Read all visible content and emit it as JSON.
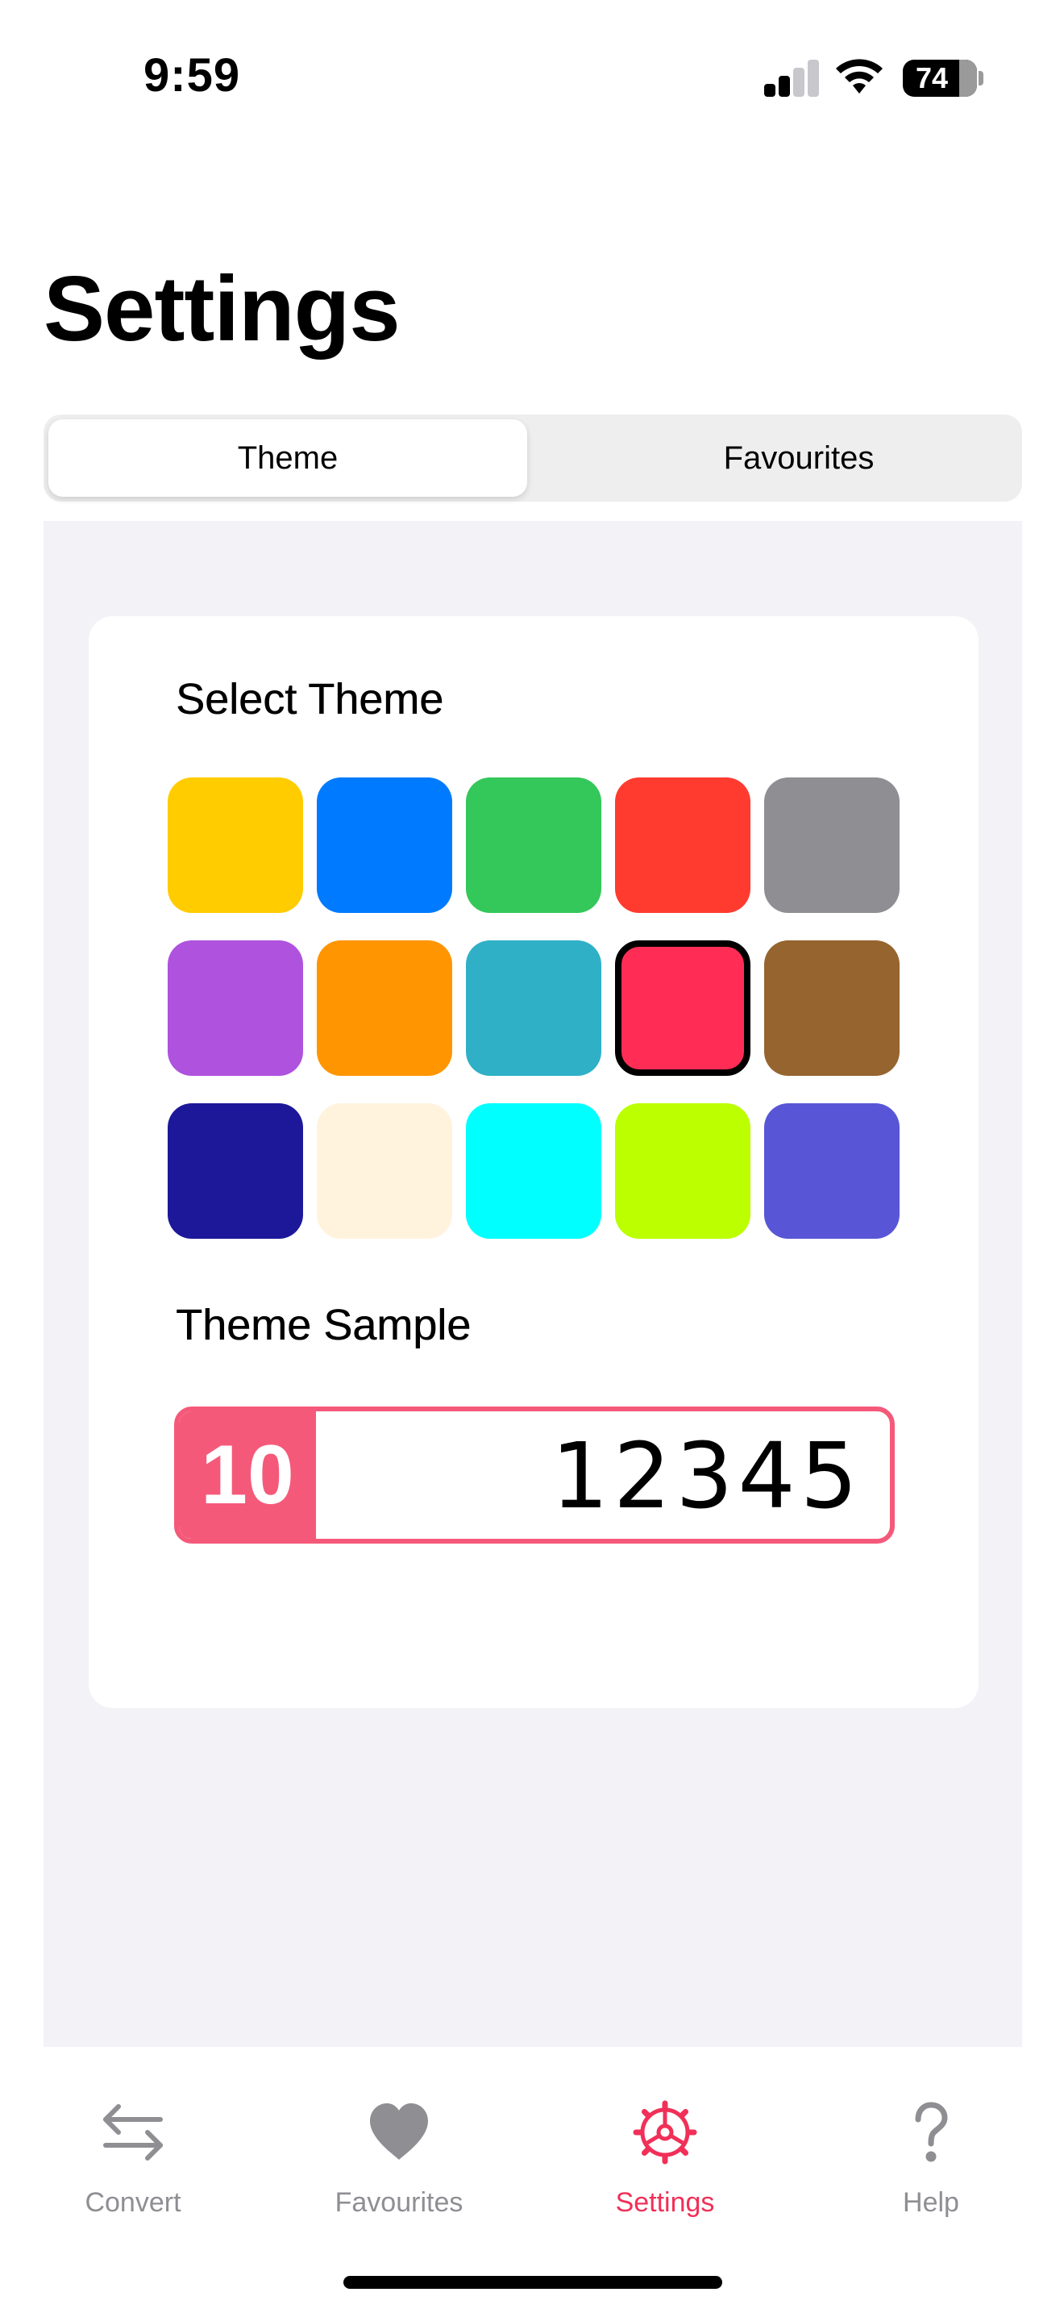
{
  "status_bar": {
    "time": "9:59",
    "battery_level": "74"
  },
  "page": {
    "title": "Settings"
  },
  "segmented_control": {
    "options": [
      "Theme",
      "Favourites"
    ],
    "selected": "Theme"
  },
  "theme_panel": {
    "select_heading": "Select Theme",
    "swatches": [
      "#FFCC00",
      "#007AFF",
      "#34C759",
      "#FF3B30",
      "#8E8E93",
      "#AF52DE",
      "#FF9500",
      "#30B0C7",
      "#FF2D55",
      "#96642F",
      "#1C1899",
      "#FFF3DE",
      "#00FFFF",
      "#BBFF00",
      "#5856D6"
    ],
    "selected_swatch_index": 8,
    "sample_heading": "Theme Sample",
    "sample": {
      "base": "10",
      "value": "12345",
      "accent_color": "#F5597A"
    }
  },
  "tab_bar": {
    "items": [
      {
        "label": "Convert",
        "icon": "arrows-left-right-icon"
      },
      {
        "label": "Favourites",
        "icon": "heart-icon"
      },
      {
        "label": "Settings",
        "icon": "gear-icon"
      },
      {
        "label": "Help",
        "icon": "question-mark-icon"
      }
    ],
    "active_index": 2,
    "active_color": "#F03058",
    "inactive_color": "#8E8E93"
  }
}
